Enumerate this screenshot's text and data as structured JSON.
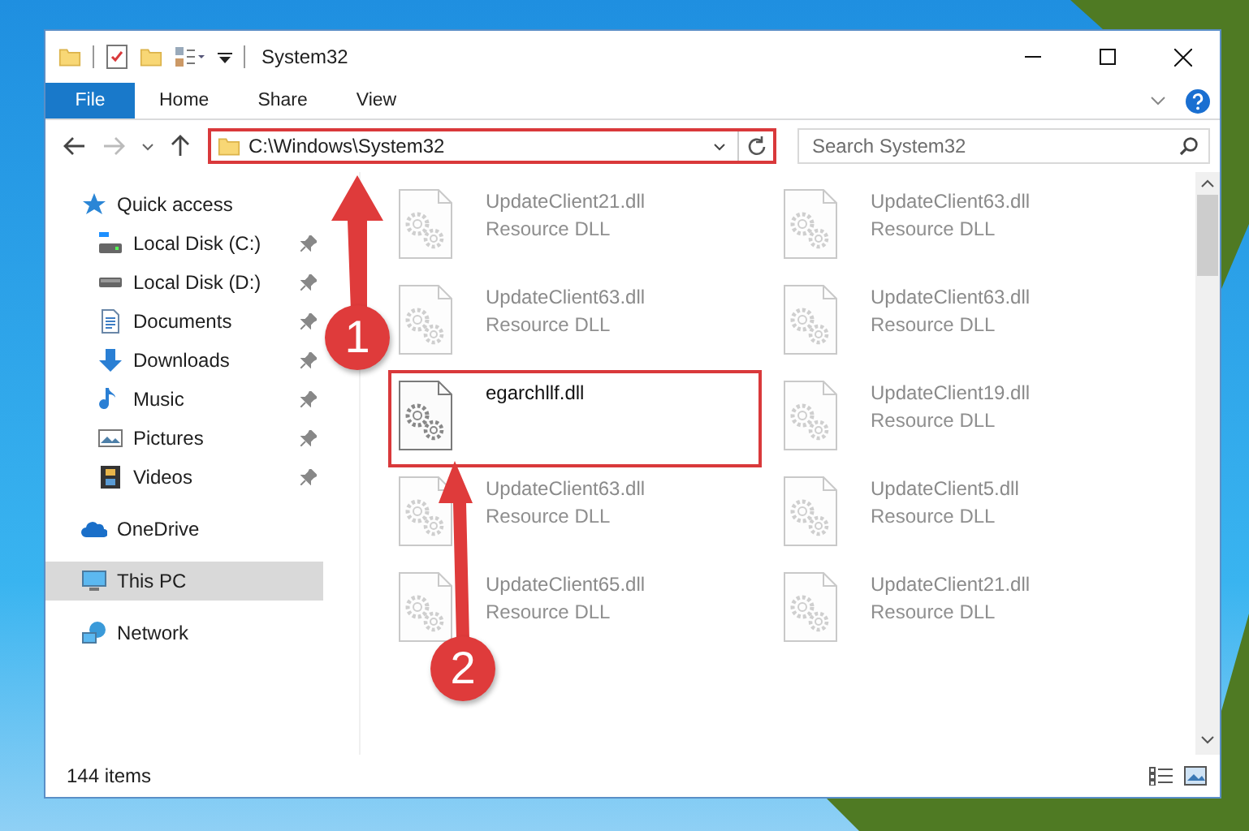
{
  "window": {
    "title": "System32"
  },
  "ribbon": {
    "tabs": [
      {
        "label": "File",
        "selected": true
      },
      {
        "label": "Home",
        "selected": false
      },
      {
        "label": "Share",
        "selected": false
      },
      {
        "label": "View",
        "selected": false
      }
    ]
  },
  "address_bar": {
    "path": "C:\\Windows\\System32",
    "highlighted": true
  },
  "search": {
    "placeholder": "Search System32"
  },
  "sidebar": {
    "items": [
      {
        "label": "Quick access",
        "kind": "star",
        "selected": false,
        "children": [
          {
            "label": "Local Disk (C:)",
            "kind": "system-drive",
            "pinned": true,
            "selected": false
          },
          {
            "label": "Local Disk (D:)",
            "kind": "drive",
            "pinned": true,
            "selected": false
          },
          {
            "label": "Documents",
            "kind": "documents",
            "pinned": true,
            "selected": false
          },
          {
            "label": "Downloads",
            "kind": "downloads",
            "pinned": true,
            "selected": false
          },
          {
            "label": "Music",
            "kind": "music",
            "pinned": true,
            "selected": false
          },
          {
            "label": "Pictures",
            "kind": "pictures",
            "pinned": true,
            "selected": false
          },
          {
            "label": "Videos",
            "kind": "videos",
            "pinned": true,
            "selected": false
          }
        ]
      },
      {
        "label": "OneDrive",
        "kind": "cloud",
        "selected": false
      },
      {
        "label": "This PC",
        "kind": "computer",
        "selected": true
      },
      {
        "label": "Network",
        "kind": "network",
        "selected": false
      }
    ]
  },
  "files": [
    {
      "name": "UpdateClient21.dll",
      "type": "Resource DLL",
      "faded": true,
      "highlighted": false
    },
    {
      "name": "UpdateClient63.dll",
      "type": "Resource DLL",
      "faded": true,
      "highlighted": false
    },
    {
      "name": "UpdateClient63.dll",
      "type": "Resource DLL",
      "faded": true,
      "highlighted": false
    },
    {
      "name": "UpdateClient63.dll",
      "type": "Resource DLL",
      "faded": true,
      "highlighted": false
    },
    {
      "name": "egarchllf.dll",
      "faded": false,
      "highlighted": true
    },
    {
      "name": "UpdateClient19.dll",
      "type": "Resource DLL",
      "faded": true,
      "highlighted": false
    },
    {
      "name": "UpdateClient63.dll",
      "type": "Resource DLL",
      "faded": true,
      "highlighted": false
    },
    {
      "name": "UpdateClient5.dll",
      "type": "Resource DLL",
      "faded": true,
      "highlighted": false
    },
    {
      "name": "UpdateClient65.dll",
      "type": "Resource DLL",
      "faded": true,
      "highlighted": false
    },
    {
      "name": "UpdateClient21.dll",
      "type": "Resource DLL",
      "faded": true,
      "highlighted": false
    }
  ],
  "status_bar": {
    "item_count": "144 items"
  },
  "callouts": [
    {
      "number": "1"
    },
    {
      "number": "2"
    }
  ]
}
